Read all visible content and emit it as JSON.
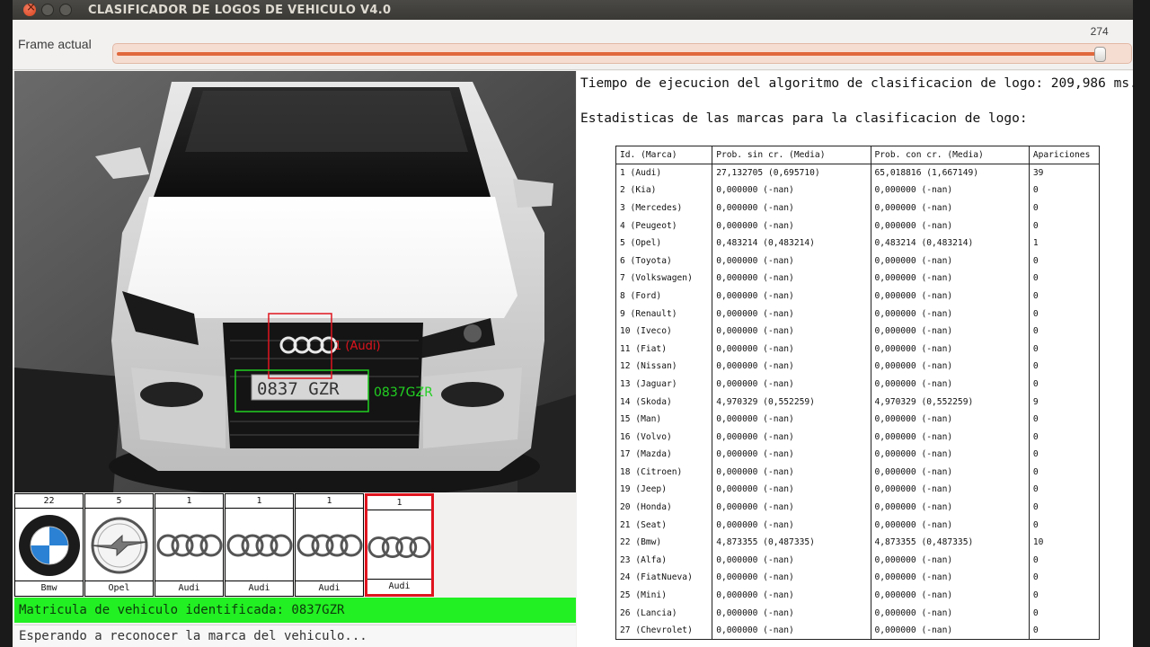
{
  "window": {
    "title": "CLASIFICADOR DE LOGOS DE VEHICULO V4.0"
  },
  "frame": {
    "label": "Frame actual",
    "value": "274",
    "min": 0,
    "max": 280
  },
  "camera": {
    "logo_detection_label": "1 (Audi)",
    "plate_detection_label": "0837GZR",
    "plate_text": "0837 GZR",
    "logo_box_color": "#e0141e",
    "plate_box_color": "#22d022"
  },
  "logo_strip": [
    {
      "count": "22",
      "name": "Bmw",
      "icon": "bmw-logo-icon",
      "selected": false
    },
    {
      "count": "5",
      "name": "Opel",
      "icon": "opel-logo-icon",
      "selected": false
    },
    {
      "count": "1",
      "name": "Audi",
      "icon": "audi-logo-icon",
      "selected": false
    },
    {
      "count": "1",
      "name": "Audi",
      "icon": "audi-logo-icon",
      "selected": false
    },
    {
      "count": "1",
      "name": "Audi",
      "icon": "audi-logo-icon",
      "selected": false
    },
    {
      "count": "1",
      "name": "Audi",
      "icon": "audi-logo-icon",
      "selected": true
    }
  ],
  "plate_bar": {
    "text": "Matricula de vehiculo identificada: 0837GZR",
    "color": "#22f022"
  },
  "status": {
    "text": "Esperando a reconocer la marca del vehiculo..."
  },
  "right_panel": {
    "exec_time": "Tiempo de ejecucion del algoritmo de clasificacion de logo: 209,986 ms.",
    "stats_title": "Estadisticas de las marcas para la clasificacion de logo:",
    "table": {
      "headers": [
        "Id. (Marca)",
        "Prob. sin cr. (Media)",
        "Prob. con cr. (Media)",
        "Apariciones"
      ],
      "rows": [
        [
          "1 (Audi)",
          "27,132705 (0,695710)",
          "65,018816 (1,667149)",
          "39"
        ],
        [
          "2 (Kia)",
          "0,000000 (-nan)",
          "0,000000 (-nan)",
          "0"
        ],
        [
          "3 (Mercedes)",
          "0,000000 (-nan)",
          "0,000000 (-nan)",
          "0"
        ],
        [
          "4 (Peugeot)",
          "0,000000 (-nan)",
          "0,000000 (-nan)",
          "0"
        ],
        [
          "5 (Opel)",
          "0,483214 (0,483214)",
          "0,483214 (0,483214)",
          "1"
        ],
        [
          "6 (Toyota)",
          "0,000000 (-nan)",
          "0,000000 (-nan)",
          "0"
        ],
        [
          "7 (Volkswagen)",
          "0,000000 (-nan)",
          "0,000000 (-nan)",
          "0"
        ],
        [
          "8 (Ford)",
          "0,000000 (-nan)",
          "0,000000 (-nan)",
          "0"
        ],
        [
          "9 (Renault)",
          "0,000000 (-nan)",
          "0,000000 (-nan)",
          "0"
        ],
        [
          "10 (Iveco)",
          "0,000000 (-nan)",
          "0,000000 (-nan)",
          "0"
        ],
        [
          "11 (Fiat)",
          "0,000000 (-nan)",
          "0,000000 (-nan)",
          "0"
        ],
        [
          "12 (Nissan)",
          "0,000000 (-nan)",
          "0,000000 (-nan)",
          "0"
        ],
        [
          "13 (Jaguar)",
          "0,000000 (-nan)",
          "0,000000 (-nan)",
          "0"
        ],
        [
          "14 (Skoda)",
          "4,970329 (0,552259)",
          "4,970329 (0,552259)",
          "9"
        ],
        [
          "15 (Man)",
          "0,000000 (-nan)",
          "0,000000 (-nan)",
          "0"
        ],
        [
          "16 (Volvo)",
          "0,000000 (-nan)",
          "0,000000 (-nan)",
          "0"
        ],
        [
          "17 (Mazda)",
          "0,000000 (-nan)",
          "0,000000 (-nan)",
          "0"
        ],
        [
          "18 (Citroen)",
          "0,000000 (-nan)",
          "0,000000 (-nan)",
          "0"
        ],
        [
          "19 (Jeep)",
          "0,000000 (-nan)",
          "0,000000 (-nan)",
          "0"
        ],
        [
          "20 (Honda)",
          "0,000000 (-nan)",
          "0,000000 (-nan)",
          "0"
        ],
        [
          "21 (Seat)",
          "0,000000 (-nan)",
          "0,000000 (-nan)",
          "0"
        ],
        [
          "22 (Bmw)",
          "4,873355 (0,487335)",
          "4,873355 (0,487335)",
          "10"
        ],
        [
          "23 (Alfa)",
          "0,000000 (-nan)",
          "0,000000 (-nan)",
          "0"
        ],
        [
          "24 (FiatNueva)",
          "0,000000 (-nan)",
          "0,000000 (-nan)",
          "0"
        ],
        [
          "25 (Mini)",
          "0,000000 (-nan)",
          "0,000000 (-nan)",
          "0"
        ],
        [
          "26 (Lancia)",
          "0,000000 (-nan)",
          "0,000000 (-nan)",
          "0"
        ],
        [
          "27 (Chevrolet)",
          "0,000000 (-nan)",
          "0,000000 (-nan)",
          "0"
        ]
      ]
    }
  }
}
